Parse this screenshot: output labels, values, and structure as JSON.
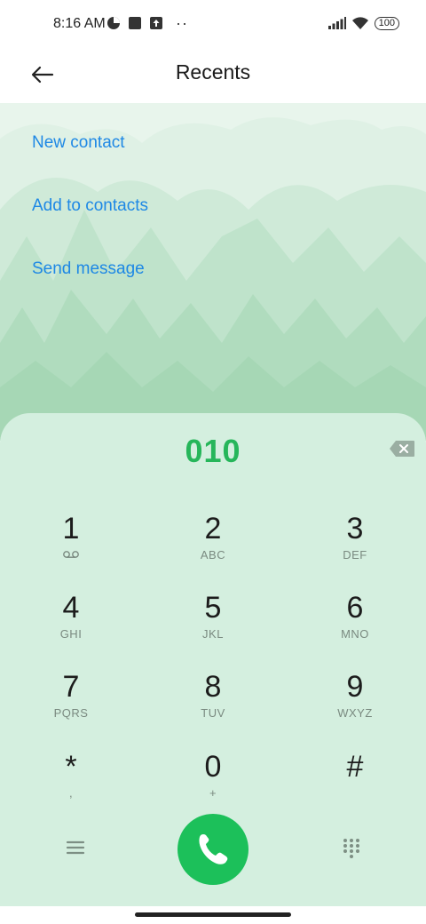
{
  "status_bar": {
    "time": "8:16 AM",
    "dots": "··",
    "battery": "100"
  },
  "header": {
    "title": "Recents"
  },
  "actions": [
    {
      "label": "New contact"
    },
    {
      "label": "Add to contacts"
    },
    {
      "label": "Send message"
    }
  ],
  "dialpad": {
    "number": "010",
    "keys": [
      {
        "digit": "1",
        "letters": ""
      },
      {
        "digit": "2",
        "letters": "ABC"
      },
      {
        "digit": "3",
        "letters": "DEF"
      },
      {
        "digit": "4",
        "letters": "GHI"
      },
      {
        "digit": "5",
        "letters": "JKL"
      },
      {
        "digit": "6",
        "letters": "MNO"
      },
      {
        "digit": "7",
        "letters": "PQRS"
      },
      {
        "digit": "8",
        "letters": "TUV"
      },
      {
        "digit": "9",
        "letters": "WXYZ"
      },
      {
        "digit": "*",
        "letters": ","
      },
      {
        "digit": "0",
        "letters": "+"
      },
      {
        "digit": "#",
        "letters": ""
      }
    ]
  },
  "colors": {
    "accent_link": "#1e88e5",
    "number_green": "#26b65a",
    "call_green": "#1cc05a",
    "panel_bg": "#d4efdf"
  },
  "icons": {
    "back": "arrow-left-icon",
    "backspace": "backspace-icon",
    "voicemail": "voicemail-icon",
    "menu": "menu-icon",
    "call": "phone-icon",
    "keypad": "keypad-icon"
  }
}
